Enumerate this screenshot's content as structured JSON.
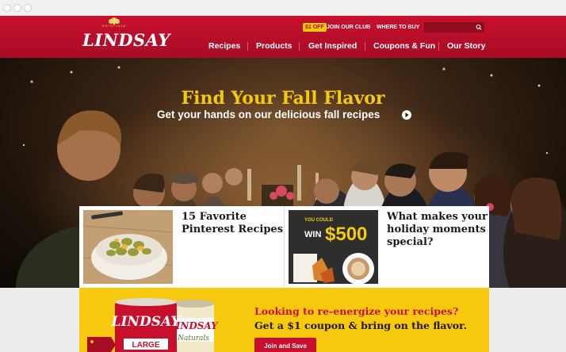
{
  "header": {
    "logo_text": "LINDSAY",
    "logo_est": "ESTD 1916",
    "offer_badge": "$1 OFF",
    "join_club": "JOIN OUR CLUB",
    "where_to_buy": "WHERE TO BUY",
    "search_placeholder": "",
    "nav": [
      "Recipes",
      "Products",
      "Get Inspired",
      "Coupons & Fun",
      "Our Story"
    ]
  },
  "hero": {
    "title": "Find Your Fall Flavor",
    "subtitle": "Get your hands on our delicious fall recipes"
  },
  "cards": [
    {
      "title": "15 Favorite Pinterest Recipes"
    },
    {
      "title": "What makes your holiday moments special?",
      "image_text_1": "YOU COULD",
      "image_text_2": "WIN",
      "image_text_3": "$500"
    }
  ],
  "promo": {
    "headline": "Looking to re-energize your recipes?",
    "subline": "Get a $1 coupon & bring on the flavor.",
    "button": "Join and Save",
    "can1_brand": "LINDSAY",
    "can1_size": "LARGE",
    "can2_brand": "LINDSAY",
    "can2_line": "Naturals"
  },
  "colors": {
    "brand_red": "#c8102e",
    "brand_yellow": "#f6c90e"
  }
}
